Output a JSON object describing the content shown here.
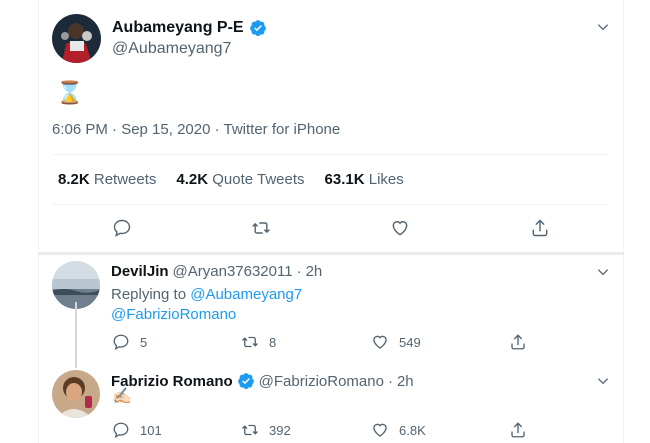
{
  "main_tweet": {
    "author_name": "Aubameyang P-E",
    "author_handle": "@Aubameyang7",
    "content_emoji": "⌛",
    "timestamp": "6:06 PM · Sep 15, 2020 · Twitter for iPhone",
    "stats": {
      "retweets_count": "8.2K",
      "retweets_label": "Retweets",
      "quote_count": "4.2K",
      "quote_label": "Quote Tweets",
      "likes_count": "63.1K",
      "likes_label": "Likes"
    }
  },
  "replies": [
    {
      "author_name": "DevilJin",
      "author_handle": "@Aryan37632011",
      "time": "2h",
      "replying_prefix": "Replying to",
      "replying_to_1": "@Aubameyang7",
      "replying_to_2": "@FabrizioRomano",
      "reply_count": "5",
      "retweet_count": "8",
      "like_count": "549"
    },
    {
      "author_name": "Fabrizio Romano",
      "author_handle": "@FabrizioRomano",
      "time": "2h",
      "content_emoji": "✍🏻",
      "reply_count": "101",
      "retweet_count": "392",
      "like_count": "6.8K"
    }
  ],
  "separator_dot": "·",
  "colors": {
    "verified": "#1d9bf0",
    "link": "#1d9bf0",
    "secondary_text": "#536471",
    "border": "#eff3f4"
  }
}
